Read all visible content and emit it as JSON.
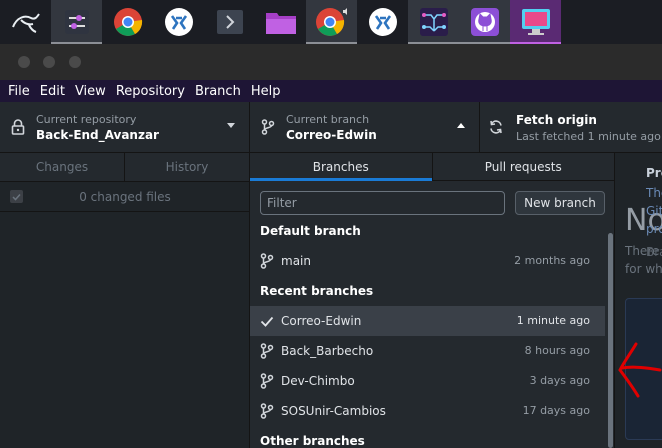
{
  "taskbar": {
    "items": [
      "kali-dragon-icon",
      "settings-sliders-icon",
      "chrome-icon",
      "vscode-icon",
      "terminal-icon",
      "folder-icon",
      "chrome-icon",
      "vscode-icon",
      "circuit-icon",
      "github-icon",
      "screenshot-icon"
    ]
  },
  "menubar": {
    "items": [
      "File",
      "Edit",
      "View",
      "Repository",
      "Branch",
      "Help"
    ]
  },
  "toolbar": {
    "repo_label": "Current repository",
    "repo_value": "Back-End_Avanzar",
    "branch_label": "Current branch",
    "branch_value": "Correo-Edwin",
    "fetch_title": "Fetch origin",
    "fetch_sub": "Last fetched 1 minute ago"
  },
  "left": {
    "tabs": [
      "Changes",
      "History"
    ],
    "changed_files": "0 changed files"
  },
  "branches": {
    "tabs": [
      "Branches",
      "Pull requests"
    ],
    "filter_placeholder": "Filter",
    "new_branch": "New branch",
    "default_header": "Default branch",
    "default_branch": {
      "name": "main",
      "time": "2 months ago"
    },
    "recent_header": "Recent branches",
    "recent": [
      {
        "name": "Correo-Edwin",
        "time": "1 minute ago",
        "current": true
      },
      {
        "name": "Back_Barbecho",
        "time": "8 hours ago"
      },
      {
        "name": "Dev-Chimbo",
        "time": "3 days ago"
      },
      {
        "name": "SOSUnir-Cambios",
        "time": "17 days ago"
      }
    ],
    "other_header": "Other branches"
  },
  "main": {
    "title": "No",
    "line1": "There a",
    "line2": "for wha",
    "card_title": "Pre",
    "card_line1": "The",
    "card_line2": "Git",
    "card_line3": "pro",
    "card_foot": "Bra"
  },
  "colors": {
    "menubar_bg": "#1e1535",
    "selected_tab_accent": "#1a7bd6",
    "annotation": "#e00000"
  }
}
